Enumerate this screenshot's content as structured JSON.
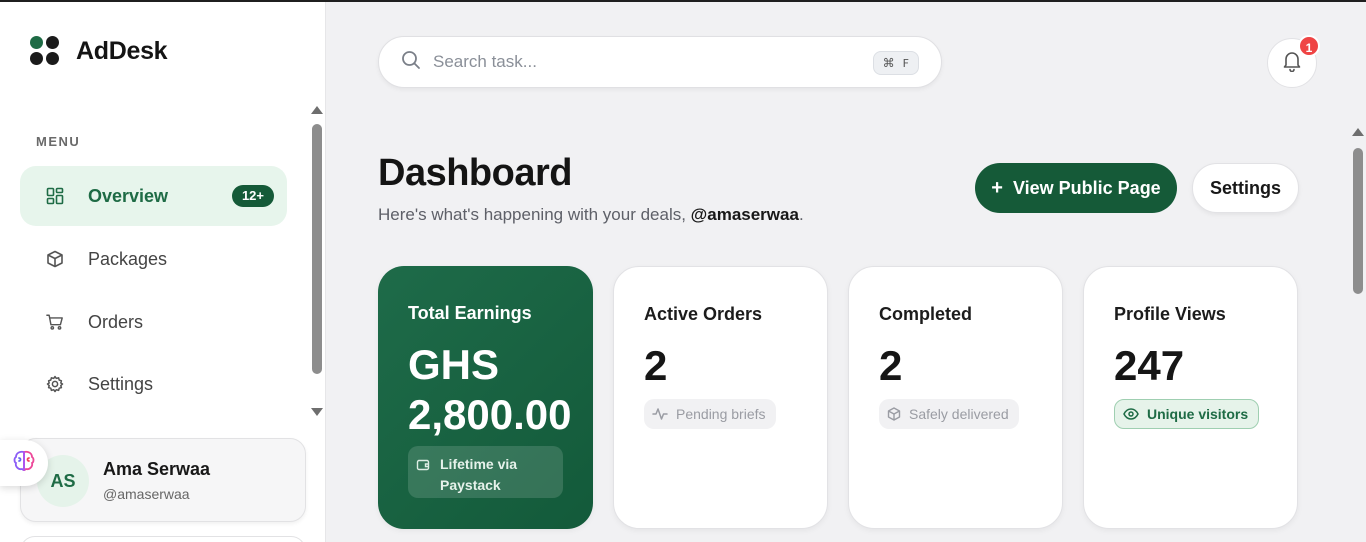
{
  "app": {
    "name": "AdDesk"
  },
  "sidebar": {
    "menu_label": "MENU",
    "items": [
      {
        "label": "Overview",
        "icon": "grid-icon",
        "badge": "12+",
        "active": true
      },
      {
        "label": "Packages",
        "icon": "box-icon"
      },
      {
        "label": "Orders",
        "icon": "cart-icon"
      },
      {
        "label": "Settings",
        "icon": "gear-icon"
      }
    ],
    "user": {
      "initials": "AS",
      "name": "Ama Serwaa",
      "handle": "@amaserwaa"
    }
  },
  "header": {
    "search_placeholder": "Search task...",
    "shortcut_symbol": "⌘",
    "shortcut_key": "F",
    "notification_count": "1"
  },
  "dashboard": {
    "title": "Dashboard",
    "subtitle_prefix": "Here's what's happening with your deals, ",
    "subtitle_handle": "@amaserwaa",
    "subtitle_suffix": ".",
    "primary_button": "View Public Page",
    "secondary_button": "Settings"
  },
  "cards": [
    {
      "title": "Total Earnings",
      "value": "GHS 2,800.00",
      "note": "Lifetime via Paystack",
      "icon": "wallet-icon"
    },
    {
      "title": "Active Orders",
      "value": "2",
      "note": "Pending briefs",
      "icon": "activity-icon"
    },
    {
      "title": "Completed",
      "value": "2",
      "note": "Safely delivered",
      "icon": "package-check-icon"
    },
    {
      "title": "Profile Views",
      "value": "247",
      "note": "Unique visitors",
      "icon": "eye-icon"
    }
  ],
  "colors": {
    "brand": "#155a38",
    "brand_light": "#e7f5ec",
    "notify": "#ef4444"
  }
}
